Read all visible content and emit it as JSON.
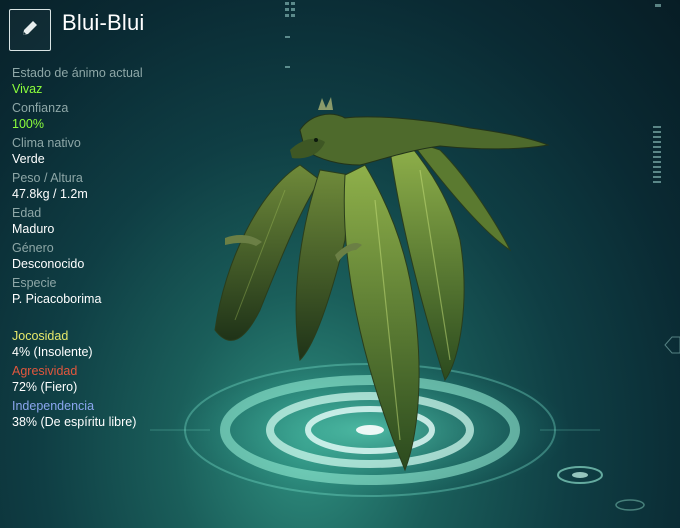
{
  "creature": {
    "name": "Blui-Blui"
  },
  "icons": {
    "edit": "pencil-icon"
  },
  "stats": [
    {
      "label": "Estado de ánimo actual",
      "value": "Vivaz",
      "highlight": true
    },
    {
      "label": "Confianza",
      "value": "100%",
      "highlight": true
    },
    {
      "label": "Clima nativo",
      "value": "Verde",
      "highlight": false
    },
    {
      "label": "Peso / Altura",
      "value": "47.8kg / 1.2m",
      "highlight": false
    },
    {
      "label": "Edad",
      "value": "Maduro",
      "highlight": false
    },
    {
      "label": "Género",
      "value": "Desconocido",
      "highlight": false
    },
    {
      "label": "Especie",
      "value": "P. Picacoborima",
      "highlight": false
    }
  ],
  "traits": [
    {
      "label": "Jocosidad",
      "value": "4% (Insolente)",
      "color": "#e6e86a"
    },
    {
      "label": "Agresividad",
      "value": "72% (Fiero)",
      "color": "#e2573d"
    },
    {
      "label": "Independencia",
      "value": "38% (De espíritu libre)",
      "color": "#8aa6ee"
    }
  ],
  "colors": {
    "positive": "#8cff3c",
    "label": "#8ea7a7"
  }
}
